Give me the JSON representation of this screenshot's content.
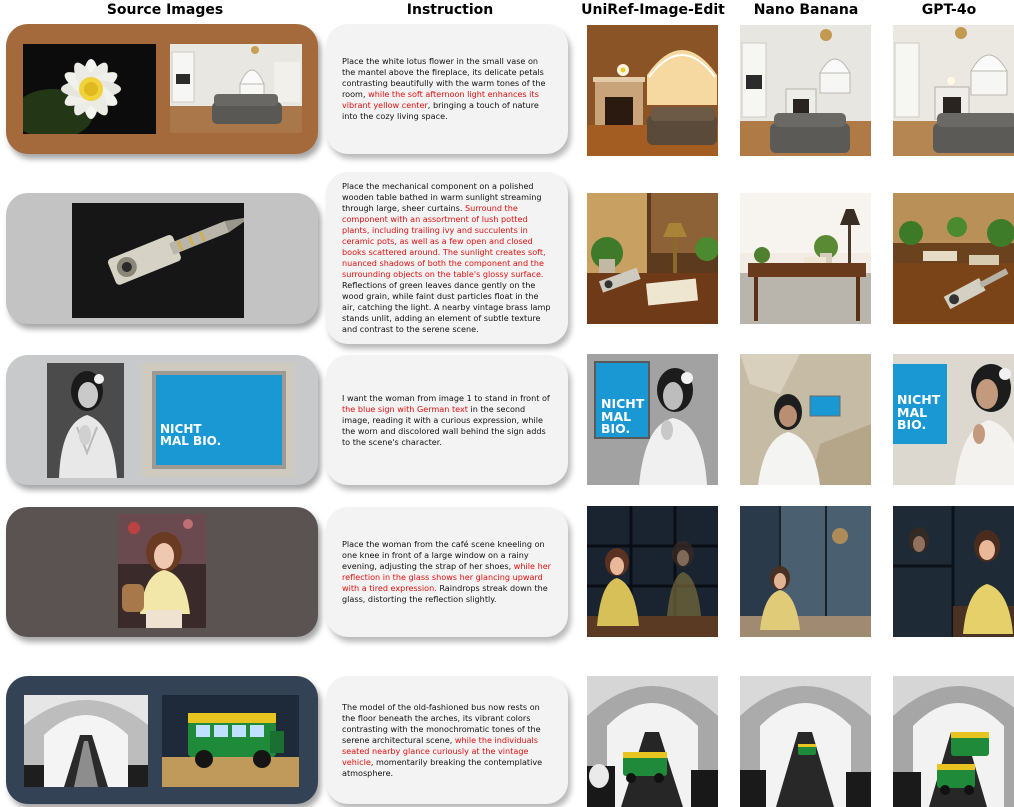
{
  "headers": {
    "source": "Source Images",
    "instruction": "Instruction",
    "uniref": "UniRef-Image-Edit",
    "nano": "Nano Banana",
    "gpt": "GPT-4o"
  },
  "rows": [
    {
      "panel_color": "#a46a3c",
      "segments": [
        {
          "t": "Place the white lotus flower in the small vase on the mantel above the fireplace, its delicate petals contrasting beautifully with the warm tones of the room, ",
          "red": false
        },
        {
          "t": "while the soft afternoon light enhances its vibrant yellow center",
          "red": true
        },
        {
          "t": ", bringing a touch of nature into the cozy living space.",
          "red": false
        }
      ]
    },
    {
      "panel_color": "#c3c3c3",
      "segments": [
        {
          "t": "Place the  mechanical component on a polished wooden table bathed in warm sunlight streaming through large, sheer curtains. ",
          "red": false
        },
        {
          "t": "Surround the component with an assortment of lush potted plants, including trailing ivy and succulents in ceramic pots, as well as a few open and closed books scattered around. The sunlight creates soft, nuanced shadows of both the component and the surrounding objects on the table's glossy surface.",
          "red": true
        },
        {
          "t": " Reflections of green leaves dance gently on the wood grain, while faint dust particles float in the air, catching the light. A nearby vintage brass lamp stands unlit, adding an element of subtle texture and contrast to the serene scene.",
          "red": false
        }
      ]
    },
    {
      "panel_color": "#c8c9ca",
      "sign_text": "NICHT MAL BIO.",
      "segments": [
        {
          "t": "I want the woman from image 1 to stand in front of ",
          "red": false
        },
        {
          "t": "the blue sign with German text",
          "red": true
        },
        {
          "t": " in the second image, reading it with a curious expression, while the worn and discolored wall behind the sign adds to the scene's character.",
          "red": false
        }
      ]
    },
    {
      "panel_color": "#5a5352",
      "segments": [
        {
          "t": "Place the woman from the café scene kneeling on one knee in front of a large window on a rainy evening, adjusting the strap of her shoes, ",
          "red": false
        },
        {
          "t": "while her reflection in the glass shows her glancing upward with a tired expression.",
          "red": true
        },
        {
          "t": " Raindrops streak down the glass, distorting the reflection slightly.",
          "red": false
        }
      ]
    },
    {
      "panel_color": "#334255",
      "segments": [
        {
          "t": "The model of the old-fashioned bus now rests on the floor beneath the arches, its vibrant colors contrasting with the monochromatic tones of the serene architectural scene, ",
          "red": false
        },
        {
          "t": "while the individuals seated nearby glance curiously at the vintage vehicle",
          "red": true
        },
        {
          "t": ", momentarily breaking the contemplative atmosphere.",
          "red": false
        }
      ]
    }
  ]
}
